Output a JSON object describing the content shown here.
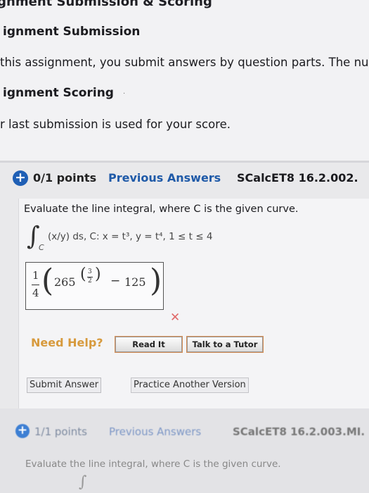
{
  "header": {
    "breadcrumb": "ignment Submission & Scoring",
    "submission_heading": "ignment Submission",
    "submission_text": "this assignment, you submit answers by question parts. The num",
    "scoring_heading": "ignment Scoring",
    "scoring_text": "r last submission is used for your score."
  },
  "question": {
    "plus_glyph": "+",
    "points": "0/1 points",
    "previous_answers": "Previous Answers",
    "code": "SCalcET8 16.2.002.",
    "prompt": "Evaluate the line integral, where C is the given curve.",
    "integral_glyph": "∫",
    "integral_sub": "C",
    "formula": "(x/y) ds,   C: x = t³,    y = t⁴,     1 ≤ t ≤ 4",
    "answer": {
      "frac_num": "1",
      "frac_den": "4",
      "paren_left": "(",
      "base": "265",
      "exp_paren_left": "(",
      "exp_num": "3",
      "exp_den": "2",
      "exp_paren_right": ")",
      "minus": "−",
      "subtrahend": "125",
      "paren_right": ")"
    },
    "result_mark": "✕",
    "need_help": "Need Help?",
    "read_it": "Read It",
    "talk_to_tutor": "Talk to a Tutor",
    "submit_answer": "Submit Answer",
    "practice_another": "Practice Another Version"
  },
  "next_question": {
    "plus_glyph": "+",
    "points": "1/1 points",
    "previous_answers": "Previous Answers",
    "code": "SCalcET8 16.2.003.MI.",
    "prompt": "Evaluate the line integral, where C is the given curve.",
    "integral_glyph": "∫"
  },
  "colors": {
    "link_blue": "#1f5aa8",
    "badge_blue": "#1f5fb5",
    "need_help_orange": "#d79a3d",
    "wrong_red": "#e06a6a"
  }
}
